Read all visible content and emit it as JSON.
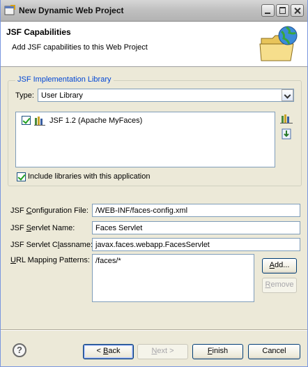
{
  "window": {
    "title": "New Dynamic Web Project"
  },
  "banner": {
    "title": "JSF Capabilities",
    "description": "Add JSF capabilities to this Web Project"
  },
  "implementation": {
    "group_label": "JSF Implementation Library",
    "type_label": "Type:",
    "type_value": "User Library",
    "libraries": [
      {
        "label": "JSF 1.2 (Apache MyFaces)",
        "checked": true
      }
    ],
    "include_label": "Include libraries with this application",
    "include_checked": true
  },
  "config": {
    "config_file_label": [
      "JSF ",
      "C",
      "onfiguration File:"
    ],
    "config_file_value": "/WEB-INF/faces-config.xml",
    "servlet_name_label": [
      "JSF ",
      "S",
      "ervlet Name:"
    ],
    "servlet_name_value": "Faces Servlet",
    "servlet_class_label": [
      "JSF Servlet C",
      "l",
      "assname:"
    ],
    "servlet_class_value": "javax.faces.webapp.FacesServlet",
    "url_label": [
      "",
      "U",
      "RL Mapping Patterns:"
    ],
    "url_patterns": [
      "/faces/*"
    ],
    "add_label": [
      "",
      "A",
      "dd..."
    ],
    "remove_label": [
      "",
      "R",
      "emove"
    ]
  },
  "buttons": {
    "help": "?",
    "back": [
      "< ",
      "B",
      "ack"
    ],
    "next": [
      "",
      "N",
      "ext >"
    ],
    "finish": [
      "",
      "F",
      "inish"
    ],
    "cancel": "Cancel"
  }
}
